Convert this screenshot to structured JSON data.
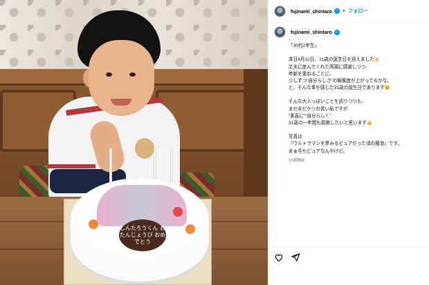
{
  "photo": {
    "cake_message": "しんたろうくん おたんじょうび おめでとう"
  },
  "header": {
    "username": "fujinami_shintaro",
    "separator": "•",
    "follow_label": "フォロー"
  },
  "post": {
    "username": "fujinami_shintaro",
    "caption_lines": [
      "、",
      "「30代2年生」",
      "",
      "本日4月12日、31歳の誕生日を迎えました🎂",
      "丈夫に産んでくれた両親に感謝しつつ、",
      "年齢を重ねるごとに、",
      "少しずつ“自分らしさ”の解像度が上がってるかな。",
      "と、そんな事を感じた31歳の誕生日であります😊",
      "",
      "そんな大人っぽいことを語りつつも、",
      "まだまだケツの青い私ですが",
      "“素直に”“自分らしく”",
      "31歳の一年間も謳歌したいと思います👍",
      "",
      "写真は",
      "『ウルトラマンを夢みるピュアだった頃の藤浪』です。",
      "まぁ今もピュアなんやけど。"
    ],
    "time_ago": "10週間前"
  },
  "actions": {
    "like_icon": "heart-icon",
    "share_icon": "send-icon"
  }
}
